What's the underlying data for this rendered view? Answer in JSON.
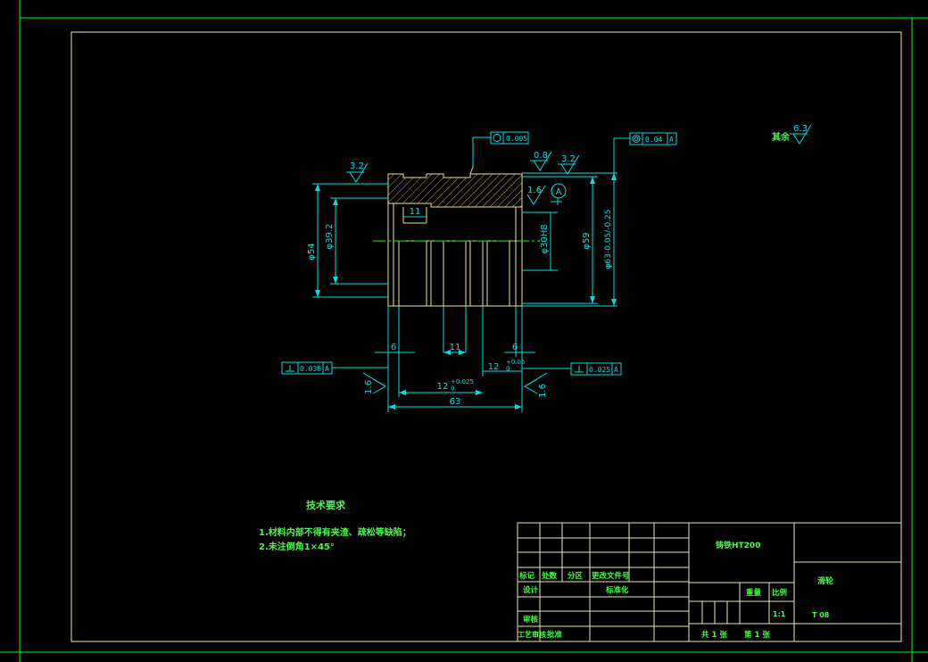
{
  "colors": {
    "background": "#000000",
    "frame": "#00ff00",
    "border": "#e8e8b0",
    "part": "#e8e0a0",
    "hatch": "#c8a850",
    "dimension": "#00e0e0",
    "note_text": "#40ff40",
    "tolerance_box": "#00e0e0"
  },
  "drawing": {
    "dimensions": {
      "phi54": "φ54",
      "phi39_2": "φ39.2",
      "phi30": "φ30H8",
      "phi59": "φ59",
      "phi63": "φ63-0.05/-0.25",
      "w11_top": "11",
      "w6_left": "6",
      "w11_mid": "11",
      "w6_right": "6",
      "w12": "12+0.05/0",
      "w12_main": "12",
      "w12_tol": "+0.05\n0",
      "w12b": "12",
      "w12b_tol": "+0.025\n0",
      "total63": "63"
    },
    "datum": "A",
    "roughness": {
      "r_3_2_left": "3.2",
      "r_0_8": "0.8",
      "r_3_2_right": "3.2",
      "r_1_6_bore": "1.6",
      "r_1_6_left": "1.6",
      "r_1_6_right": "1.6",
      "r_rest": "6.3",
      "rest_label": "其余"
    },
    "tolerance_frames": {
      "roundness": "0.005",
      "runout": "0.04",
      "runout_datum": "A",
      "perp_left": "0.036",
      "perp_left_datum": "A",
      "perp_right": "0.025",
      "perp_right_datum": "A"
    }
  },
  "notes": {
    "title": "技术要求",
    "line1": "1.材料内部不得有夹渣、疏松等缺陷；",
    "line2": "2.未注倒角1×45°"
  },
  "title_block": {
    "material": "铸铁HT200",
    "part_name": "滑轮",
    "drawing_no": "T  08",
    "mark": "标记",
    "count": "处数",
    "zone": "分区",
    "change_doc": "更改文件号",
    "design": "设计",
    "standardize": "标准化",
    "review": "审核",
    "process": "工艺",
    "approve": "批准",
    "process_review": "工艺审核",
    "weight": "重量",
    "scale": "比例",
    "scale_value": "1:1",
    "sheets_total": "共 1 张",
    "sheet_no": "第 1 张"
  }
}
